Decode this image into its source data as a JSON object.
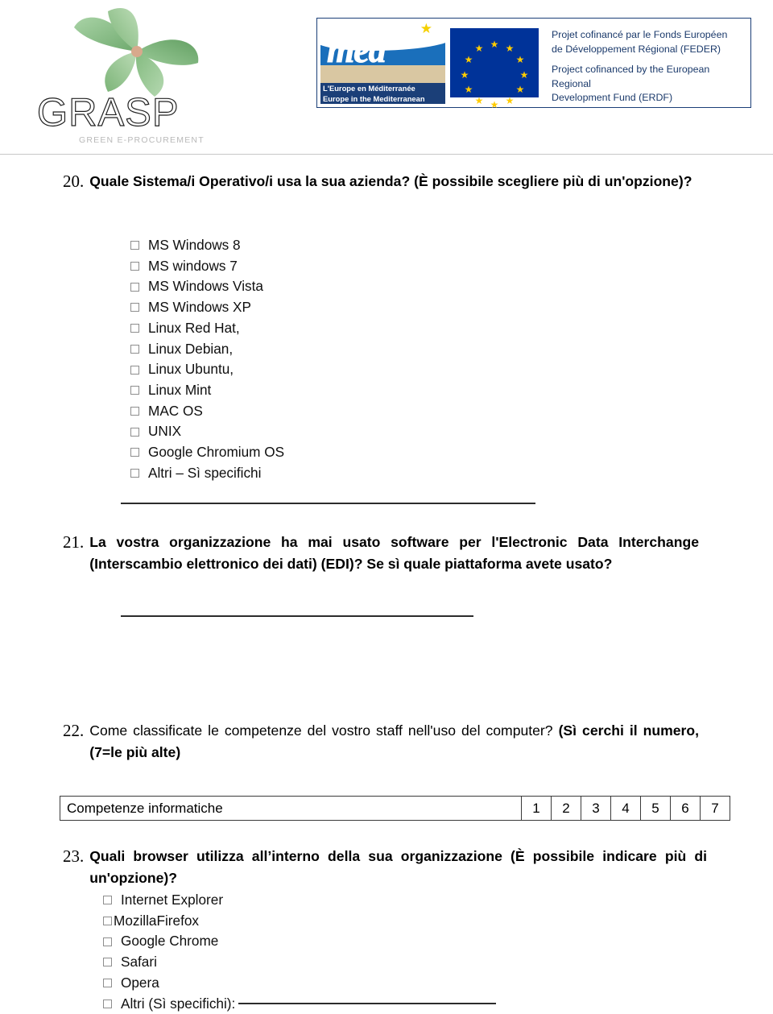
{
  "header": {
    "grasp_logo": {
      "wordmark": "GRASP",
      "tagline": "GREEN E-PROCUREMENT",
      "icon": "pinwheel-icon",
      "color": "#8bbf8b"
    },
    "med_logo": {
      "wordmark": "med",
      "subtitle_fr": "L'Europe en Méditerranée",
      "subtitle_en": "Europe in the Mediterranean",
      "band_color": "#1b3f78",
      "sky_color": "#1a6fbb"
    },
    "eu_funding": {
      "flag": "eu-flag-icon",
      "flag_color": "#003399",
      "star_color": "#ffcc00",
      "text_fr_line1": "Projet cofinancé par le Fonds Européen",
      "text_fr_line2": "de Développement Régional (FEDER)",
      "text_en_line1": "Project cofinanced by the European Regional",
      "text_en_line2": "Development Fund (ERDF)"
    }
  },
  "questions": {
    "q20": {
      "number": "20.",
      "text": "Quale Sistema/i Operativo/i usa la sua azienda? (È possibile scegliere più di un'opzione)?",
      "options": [
        "MS Windows 8",
        "MS windows 7",
        "MS Windows Vista",
        "MS Windows XP",
        "Linux  Red Hat,",
        "Linux  Debian,",
        "Linux  Ubuntu,",
        "Linux Mint",
        "MAC OS",
        "UNIX",
        "Google Chromium OS",
        "Altri – Sì specifichi"
      ]
    },
    "q21": {
      "number": "21.",
      "text": "La vostra organizzazione ha mai usato software per l'Electronic Data Interchange (Interscambio elettronico dei dati) (EDI)? Se sì quale piattaforma avete usato?"
    },
    "q22": {
      "number": "22.",
      "text_regular": "Come classificate le competenze del vostro staff nell'uso del computer?",
      "text_bold": "(Sì cerchi il numero, (7=le più alte)",
      "table": {
        "row_label": "Competenze informatiche",
        "scores": [
          "1",
          "2",
          "3",
          "4",
          "5",
          "6",
          "7"
        ]
      }
    },
    "q23": {
      "number": "23.",
      "text": "Quali browser utilizza all’interno della sua organizzazione (È possibile indicare più di un'opzione)?",
      "options": [
        "Internet Explorer",
        "MozillaFirefox",
        "Google Chrome",
        "Safari",
        "Opera",
        "Altri (Sì specifichi):"
      ]
    }
  }
}
